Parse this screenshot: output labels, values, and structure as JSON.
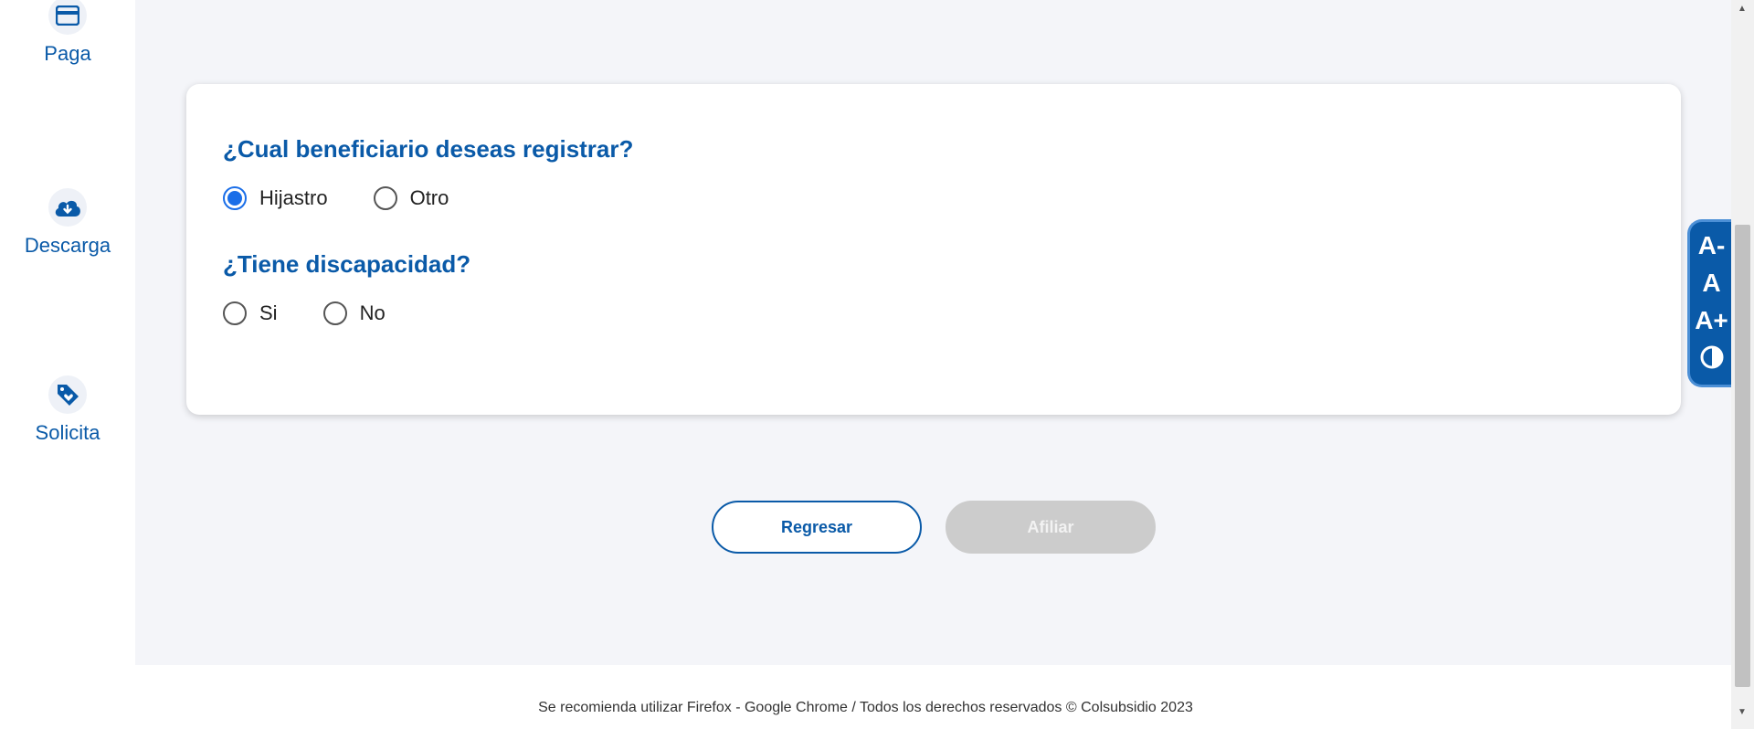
{
  "sidebar": {
    "items": [
      {
        "label": "Paga",
        "icon": "credit-card-icon"
      },
      {
        "label": "Descarga",
        "icon": "cloud-download-icon"
      },
      {
        "label": "Solicita",
        "icon": "tag-heart-icon"
      }
    ]
  },
  "form": {
    "q1": {
      "title": "¿Cual beneficiario deseas registrar?",
      "options": [
        "Hijastro",
        "Otro"
      ],
      "selected": "Hijastro"
    },
    "q2": {
      "title": "¿Tiene discapacidad?",
      "options": [
        "Si",
        "No"
      ],
      "selected": null
    }
  },
  "buttons": {
    "back": "Regresar",
    "submit": "Afiliar"
  },
  "a11y": {
    "decrease": "A-",
    "normal": "A",
    "increase": "A+",
    "contrast_icon": "contrast-icon"
  },
  "footer": {
    "text": "Se recomienda utilizar Firefox - Google Chrome / Todos los derechos reservados © Colsubsidio 2023"
  },
  "colors": {
    "brand": "#0a5aa8",
    "radio_selected": "#1a6ee8",
    "background": "#f4f5f9",
    "disabled": "#cccccc"
  }
}
